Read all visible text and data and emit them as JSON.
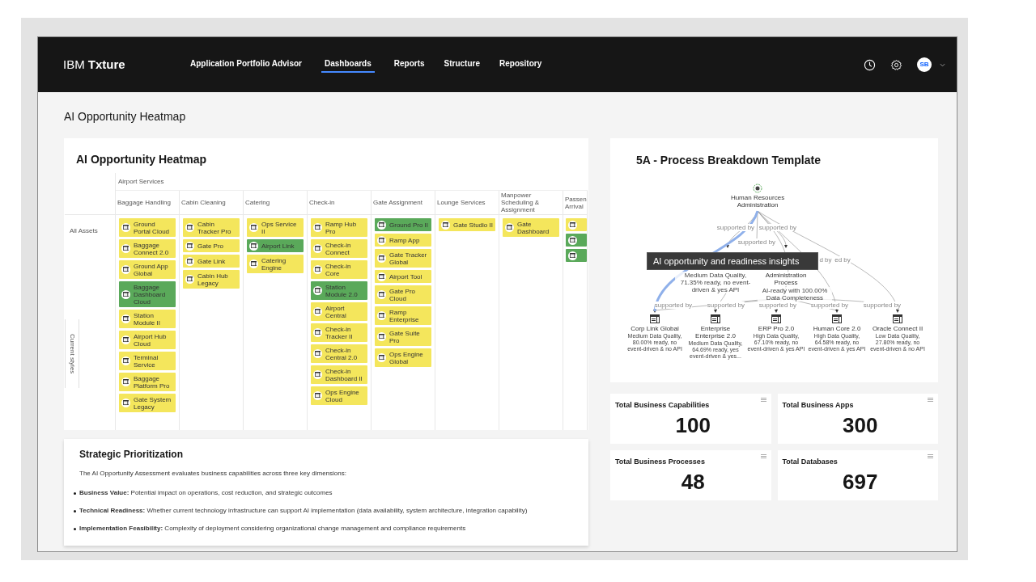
{
  "nav": {
    "logo": "IBM **Txture**",
    "links": [
      {
        "label": "Application Portfolio Advisor",
        "selected": false
      },
      {
        "label": "Dashboards",
        "selected": true
      },
      {
        "label": "Reports",
        "selected": false
      },
      {
        "label": "Structure",
        "selected": false
      },
      {
        "label": "Repository",
        "selected": false
      }
    ],
    "avatar": "SB"
  },
  "page_title": "AI Opportunity Heatmap",
  "heatmap": {
    "title": "AI Opportunity Heatmap",
    "group": "Airport Services",
    "row_label": "All Assets",
    "side_label": "Current styles",
    "columns": [
      {
        "header": "Baggage Handling",
        "items": [
          {
            "label": "Ground Portal Cloud",
            "color": "#f4e65c"
          },
          {
            "label": "Baggage Connect 2.0",
            "color": "#f4e65c"
          },
          {
            "label": "Ground App Global",
            "color": "#f4e65c"
          },
          {
            "label": "Baggage Dashboard Cloud",
            "color": "#5aa95a"
          },
          {
            "label": "Station Module II",
            "color": "#f4e65c"
          },
          {
            "label": "Airport Hub Cloud",
            "color": "#f4e65c"
          },
          {
            "label": "Terminal Service",
            "color": "#f4e65c"
          },
          {
            "label": "Baggage Platform Pro",
            "color": "#f4e65c"
          },
          {
            "label": "Gate System Legacy",
            "color": "#f4e65c"
          }
        ]
      },
      {
        "header": "Cabin Cleaning",
        "items": [
          {
            "label": "Cabin Tracker Pro",
            "color": "#f4e65c"
          },
          {
            "label": "Gate Pro",
            "color": "#f4e65c"
          },
          {
            "label": "Gate Link",
            "color": "#f4e65c"
          },
          {
            "label": "Cabin Hub Legacy",
            "color": "#f4e65c"
          }
        ]
      },
      {
        "header": "Catering",
        "items": [
          {
            "label": "Ops Service II",
            "color": "#f4e65c"
          },
          {
            "label": "Airport Link",
            "color": "#5aa95a"
          },
          {
            "label": "Catering Engine",
            "color": "#f4e65c"
          }
        ]
      },
      {
        "header": "Check-in",
        "items": [
          {
            "label": "Ramp Hub Pro",
            "color": "#f4e65c"
          },
          {
            "label": "Check-in Connect",
            "color": "#f4e65c"
          },
          {
            "label": "Check-in Core",
            "color": "#f4e65c"
          },
          {
            "label": "Station Module 2.0",
            "color": "#5aa95a"
          },
          {
            "label": "Airport Central",
            "color": "#f4e65c"
          },
          {
            "label": "Check-in Tracker II",
            "color": "#f4e65c"
          },
          {
            "label": "Check-in Central 2.0",
            "color": "#f4e65c"
          },
          {
            "label": "Check-in Dashboard II",
            "color": "#f4e65c"
          },
          {
            "label": "Ops Engine Cloud",
            "color": "#f4e65c"
          }
        ]
      },
      {
        "header": "Gate Assignment",
        "items": [
          {
            "label": "Ground Pro II",
            "color": "#5aa95a"
          },
          {
            "label": "Ramp App",
            "color": "#f4e65c"
          },
          {
            "label": "Gate Tracker Global",
            "color": "#f4e65c"
          },
          {
            "label": "Airport Tool",
            "color": "#f4e65c"
          },
          {
            "label": "Gate Pro Cloud",
            "color": "#f4e65c"
          },
          {
            "label": "Ramp Enterprise",
            "color": "#f4e65c"
          },
          {
            "label": "Gate Suite Pro",
            "color": "#f4e65c"
          },
          {
            "label": "Ops Engine Global",
            "color": "#f4e65c"
          }
        ]
      },
      {
        "header": "Lounge Services",
        "items": [
          {
            "label": "Gate Studio II",
            "color": "#f4e65c"
          }
        ]
      },
      {
        "header": "Manpower Scheduling & Assignment",
        "items": [
          {
            "label": "Gate Dashboard",
            "color": "#f4e65c"
          }
        ]
      },
      {
        "header": "Passen Arrival",
        "items": [
          {
            "color": "#f4e65c"
          },
          {
            "color": "#5aa95a"
          },
          {
            "color": "#5aa95a"
          }
        ]
      }
    ]
  },
  "strategic": {
    "title": "Strategic Prioritization",
    "intro": "The AI Opportunity Assessment evaluates business capabilities across three key dimensions:",
    "bullets": [
      "**Business Value:** Potential impact on operations, cost reduction, and strategic outcomes",
      "**Technical Readiness:** Whether current technology infrastructure can support AI implementation (data availability, system architecture, integration capability)",
      "**Implementation Feasibility:** Complexity of deployment considering organizational change management and compliance requirements"
    ]
  },
  "process": {
    "title": "5A - Process Breakdown Template",
    "root": "Human Resources Administration",
    "middle_nodes": [
      {
        "details": "Medium Data Quality, 71.35% ready, no event-driven & yes API"
      },
      {
        "label": "Administration Process",
        "details": "AI-ready with 100.00% Data Completeness"
      }
    ],
    "edge_labels": [
      "supported by",
      "supported by",
      "supported by",
      "d by",
      "ed by",
      "supported by",
      "supported by",
      "supported by",
      "supported by",
      "supported by"
    ],
    "leaves": [
      {
        "label": "Corp Link Global",
        "details": "Medium Data Quality, 80.00% ready, no event-driven & no API"
      },
      {
        "label": "Enterprise Enterprise 2.0",
        "details": "Medium Data Quality, 64.69% ready, yes event-driven & yes..."
      },
      {
        "label": "ERP Pro 2.0",
        "details": "High Data Quality, 67.10% ready, no event-driven & yes API"
      },
      {
        "label": "Human Core 2.0",
        "details": "High Data Quality, 64.58% ready, no event-driven & yes API"
      },
      {
        "label": "Oracle Connect II",
        "details": "Low Data Quality, 27.80% ready, no event-driven & no API"
      }
    ],
    "tooltip": "AI opportunity and readiness insights"
  },
  "kpis": [
    {
      "title": "Total Business Capabilities",
      "value": "100"
    },
    {
      "title": "Total Business Apps",
      "value": "300"
    },
    {
      "title": "Total Business Processes",
      "value": "48"
    },
    {
      "title": "Total Databases",
      "value": "697"
    }
  ]
}
